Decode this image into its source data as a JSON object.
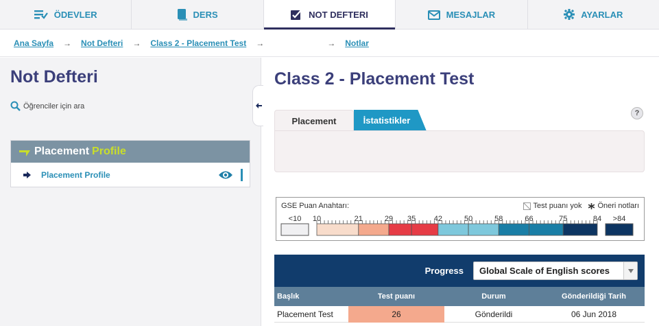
{
  "nav": {
    "tabs": [
      {
        "label": "ÖDEVLER",
        "icon": "assignments-icon"
      },
      {
        "label": "DERS",
        "icon": "book-icon"
      },
      {
        "label": "NOT DEFTERI",
        "icon": "gradebook-icon",
        "active": true
      },
      {
        "label": "MESAJLAR",
        "icon": "messages-icon"
      },
      {
        "label": "AYARLAR",
        "icon": "gear-icon"
      }
    ]
  },
  "breadcrumb": {
    "items": [
      "Ana Sayfa",
      "Not Defteri",
      "Class 2 - Placement Test",
      "Notlar"
    ],
    "separator": "→"
  },
  "left": {
    "title": "Not Defteri",
    "search_label": "Öğrenciler için ara",
    "profile_header_main": "Placement",
    "profile_header_highlight": "Profile",
    "profile_item": "Placement Profile"
  },
  "main": {
    "title": "Class 2 - Placement Test",
    "help": "?",
    "subtabs": [
      "Placement",
      "İstatistikler"
    ]
  },
  "gse_key": {
    "label": "GSE Puan Anahtarı:",
    "legend_no_score": "Test puanı yok",
    "legend_notes": "Öneri notları",
    "low_label": "<10",
    "high_label": ">84",
    "ticks": [
      "10",
      "21",
      "29",
      "35",
      "42",
      "50",
      "58",
      "66",
      "75",
      "84"
    ],
    "band_colors": [
      "#f8dccb",
      "#f4a98d",
      "#e63c46",
      "#e63c46",
      "#7ec8dc",
      "#7ec8dc",
      "#1a7ea6",
      "#1a7ea6",
      "#0d3562"
    ]
  },
  "progress": {
    "label": "Progress",
    "select_value": "Global Scale of English scores",
    "columns": [
      "Başlık",
      "Test puanı",
      "Durum",
      "Gönderildiği Tarih"
    ],
    "rows": [
      {
        "title": "Placement Test",
        "score": "26",
        "status": "Gönderildi",
        "date": "06 Jun 2018"
      }
    ]
  },
  "colors": {
    "accent": "#2a8fb6",
    "title": "#3b3f7a",
    "header_dark": "#113c6c",
    "table_header": "#5e7f99",
    "score_cell": "#f4a98d"
  }
}
